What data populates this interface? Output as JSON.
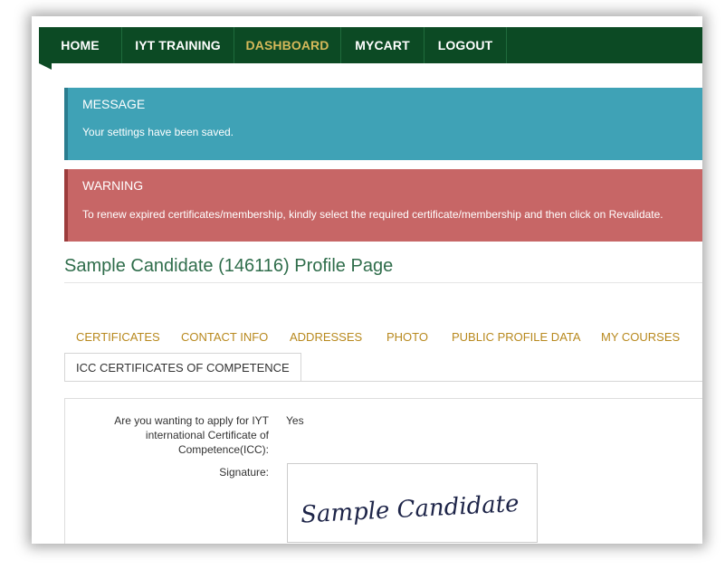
{
  "nav": {
    "items": [
      "HOME",
      "IYT TRAINING",
      "DASHBOARD",
      "MYCART",
      "LOGOUT"
    ],
    "active": "DASHBOARD"
  },
  "alerts": {
    "message": {
      "title": "MESSAGE",
      "text": "Your settings have been saved."
    },
    "warning": {
      "title": "WARNING",
      "text": "To renew expired certificates/membership, kindly select the required certificate/membership and then click on Revalidate."
    }
  },
  "page": {
    "title": "Sample Candidate (146116) Profile Page"
  },
  "tabs": {
    "links": [
      "CERTIFICATES",
      "CONTACT INFO",
      "ADDRESSES",
      "PHOTO",
      "PUBLIC PROFILE DATA",
      "MY COURSES"
    ],
    "active": "ICC CERTIFICATES OF COMPETENCE"
  },
  "form": {
    "apply_label": [
      "Are you wanting to apply for IYT",
      "international Certificate of",
      "Competence(ICC):"
    ],
    "apply_value": "Yes",
    "signature_label": "Signature:",
    "signature_text": "Sample Candidate"
  },
  "colors": {
    "nav_bg": "#0c4a24",
    "nav_active": "#d6b95a",
    "alert_info": "#3fa2b6",
    "alert_warning": "#c76666",
    "title_green": "#2f6d4b",
    "tab_link": "#b8891e"
  }
}
